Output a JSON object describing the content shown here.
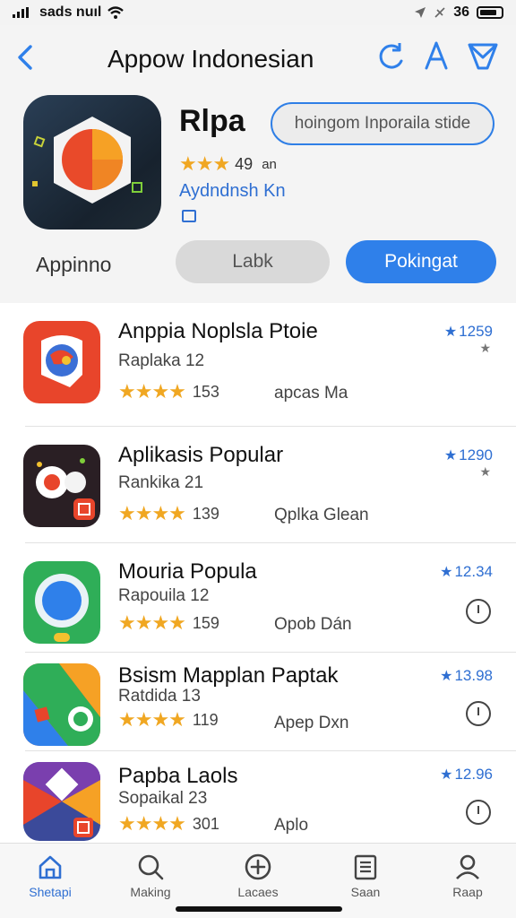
{
  "status": {
    "carrier": "sads nuıl",
    "time": "36"
  },
  "nav": {
    "title": "Appow Indonesian"
  },
  "hero": {
    "name": "Rlpa",
    "pill": "hoingom Inporaila stide",
    "rating_count": "49",
    "rating_unit": "an",
    "developer": "Aydndnsh Kn",
    "left_label": "Appinno",
    "button_gray": "Labk",
    "button_blue": "Pokingat"
  },
  "list": [
    {
      "title": "Anppia Noplsla Ptoie",
      "subtitle": "Raplaka 12",
      "rating_count": "153",
      "meta": "apcas Ma",
      "score": "1259",
      "action": "small-star"
    },
    {
      "title": "Aplikasis Popular",
      "subtitle": "Rankika 21",
      "rating_count": "139",
      "meta": "Qplka Glean",
      "score": "1290",
      "action": "small-star"
    },
    {
      "title": "Mouria Popula",
      "subtitle": "Rapouila 12",
      "rating_count": "159",
      "meta": "Opob Dán",
      "score": "12.34",
      "action": "clock"
    },
    {
      "title": "Bsism Mapplan Paptak",
      "subtitle": "Ratdida 13",
      "rating_count": "119",
      "meta": "Apep Dxn",
      "score": "13.98",
      "action": "clock"
    },
    {
      "title": "Papba Laols",
      "subtitle": "Sopaikal 23",
      "rating_count": "301",
      "meta": "Aplo",
      "score": "12.96",
      "action": "clock"
    }
  ],
  "tabs": [
    {
      "label": "Shetapi",
      "icon": "home-icon",
      "active": true
    },
    {
      "label": "Making",
      "icon": "search-icon",
      "active": false
    },
    {
      "label": "Lacaes",
      "icon": "add-icon",
      "active": false
    },
    {
      "label": "Saan",
      "icon": "list-icon",
      "active": false
    },
    {
      "label": "Raap",
      "icon": "profile-icon",
      "active": false
    }
  ],
  "colors": {
    "accent": "#2f80ea",
    "link": "#2f6fd2",
    "star": "#f0a722"
  }
}
